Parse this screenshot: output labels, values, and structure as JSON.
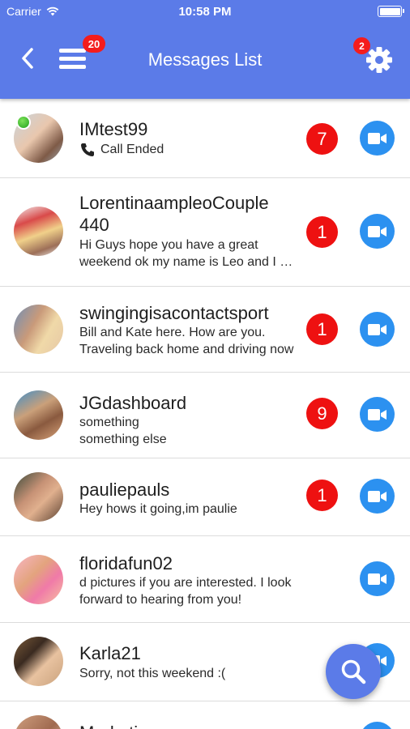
{
  "status_bar": {
    "carrier": "Carrier",
    "time": "10:58 PM"
  },
  "header": {
    "title": "Messages List",
    "menu_badge": "20",
    "settings_badge": "2",
    "background_color": "#5b7be8"
  },
  "conversations": [
    {
      "name": "IMtest99",
      "preview": "Call Ended",
      "preview_icon": "phone-icon",
      "unread": "7",
      "online": true
    },
    {
      "name": "LorentinaampleoCouple 440",
      "preview_line1": "Hi Guys hope you have a great",
      "preview_line2": "weekend ok my name is Leo and I am",
      "unread": "1"
    },
    {
      "name": "swingingisacontactsport",
      "preview_line1": "Bill and Kate here. How are you.",
      "preview_line2": "Traveling back home and driving now",
      "unread": "1"
    },
    {
      "name": "JGdashboard",
      "preview_line1": "something",
      "preview_line2": "something else",
      "unread": "9"
    },
    {
      "name": "pauliepauls",
      "preview": "Hey hows it going,im paulie",
      "unread": "1"
    },
    {
      "name": "floridafun02",
      "preview_line1": "d pictures if you are interested. I look",
      "preview_line2": "forward to hearing from you!"
    },
    {
      "name": "Karla21",
      "preview": "Sorry, not this weekend :("
    },
    {
      "name": "Marketing"
    }
  ],
  "colors": {
    "unread_badge": "#ee1111",
    "video_button": "#2c91f0",
    "accent": "#5b7be8"
  }
}
